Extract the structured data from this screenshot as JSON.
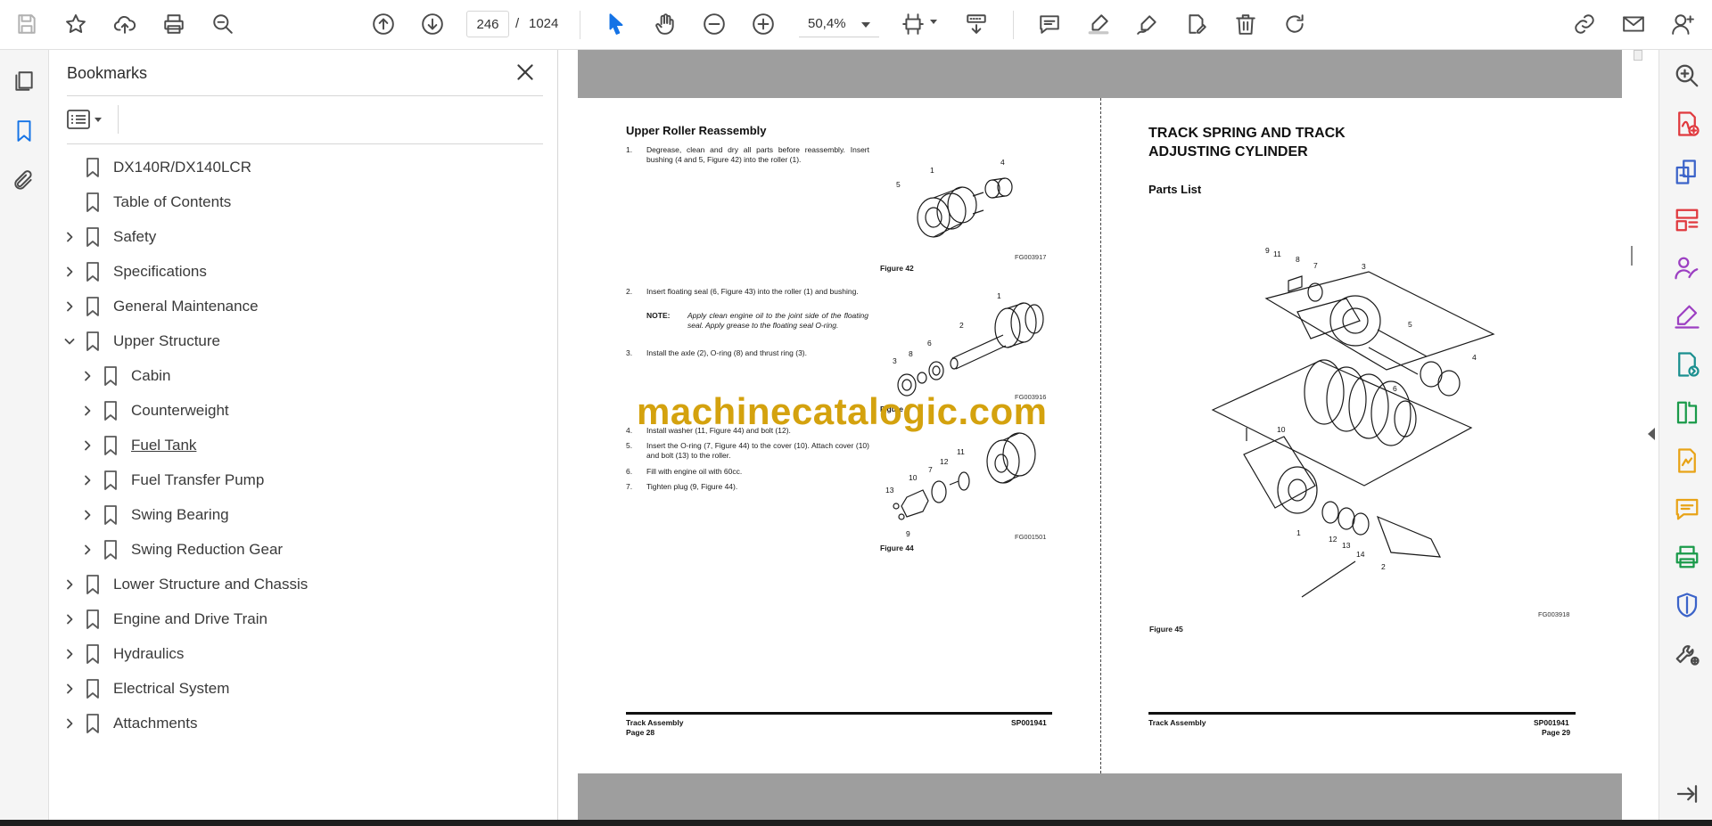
{
  "toolbar": {
    "current_page": "246",
    "page_separator": "/",
    "total_pages": "1024",
    "zoom": "50,4%"
  },
  "bookmarks": {
    "title": "Bookmarks",
    "items": [
      {
        "label": "DX140R/DX140LCR",
        "level": 0,
        "chevron": "none"
      },
      {
        "label": "Table of Contents",
        "level": 0,
        "chevron": "none"
      },
      {
        "label": "Safety",
        "level": 0,
        "chevron": "right"
      },
      {
        "label": "Specifications",
        "level": 0,
        "chevron": "right"
      },
      {
        "label": "General Maintenance",
        "level": 0,
        "chevron": "right"
      },
      {
        "label": "Upper Structure",
        "level": 0,
        "chevron": "down"
      },
      {
        "label": "Cabin",
        "level": 1,
        "chevron": "right"
      },
      {
        "label": "Counterweight",
        "level": 1,
        "chevron": "right"
      },
      {
        "label": "Fuel Tank",
        "level": 1,
        "chevron": "right",
        "underlined": true
      },
      {
        "label": "Fuel Transfer Pump",
        "level": 1,
        "chevron": "right"
      },
      {
        "label": "Swing Bearing",
        "level": 1,
        "chevron": "right"
      },
      {
        "label": "Swing Reduction Gear",
        "level": 1,
        "chevron": "right"
      },
      {
        "label": "Lower Structure and Chassis",
        "level": 0,
        "chevron": "right"
      },
      {
        "label": "Engine and Drive Train",
        "level": 0,
        "chevron": "right"
      },
      {
        "label": "Hydraulics",
        "level": 0,
        "chevron": "right"
      },
      {
        "label": "Electrical System",
        "level": 0,
        "chevron": "right"
      },
      {
        "label": "Attachments",
        "level": 0,
        "chevron": "right"
      }
    ]
  },
  "left_page": {
    "heading": "Upper Roller Reassembly",
    "steps": [
      {
        "num": "1.",
        "text": "Degrease, clean and dry all parts before reassembly. Insert bushing (4 and 5, Figure 42) into the roller (1)."
      },
      {
        "num": "2.",
        "text": "Insert floating seal (6, Figure 43) into the roller (1) and bushing."
      },
      {
        "num": "3.",
        "text": "Install the axle (2), O-ring (8) and thrust ring (3)."
      },
      {
        "num": "4.",
        "text": "Install washer (11, Figure 44) and bolt (12)."
      },
      {
        "num": "5.",
        "text": "Insert the O-ring (7, Figure 44) to the cover (10). Attach cover (10) and bolt (13) to the roller."
      },
      {
        "num": "6.",
        "text": "Fill with engine oil with 60cc."
      },
      {
        "num": "7.",
        "text": "Tighten plug (9, Figure 44)."
      }
    ],
    "note_label": "NOTE:",
    "note_text": "Apply clean engine oil to the joint side of the floating seal. Apply grease to the floating seal O-ring.",
    "fig42": {
      "caption": "Figure 42",
      "code": "FG003917",
      "callouts": [
        "5",
        "1",
        "4"
      ]
    },
    "fig43": {
      "caption": "Figure 4",
      "code": "FG003916",
      "callouts": [
        "1",
        "2",
        "3",
        "8",
        "6"
      ]
    },
    "fig44": {
      "caption": "Figure 44",
      "code": "FG001501",
      "callouts": [
        "10",
        "7",
        "12",
        "11",
        "13",
        "9"
      ]
    },
    "footer_left": "Track Assembly",
    "footer_page": "Page 28",
    "footer_right": "SP001941"
  },
  "right_page": {
    "title_line1": "TRACK SPRING AND TRACK",
    "title_line2": "ADJUSTING CYLINDER",
    "subheading": "Parts List",
    "fig45": {
      "caption": "Figure 45",
      "code": "FG003918",
      "callouts": [
        "9",
        "11",
        "8",
        "7",
        "3",
        "5",
        "4",
        "6",
        "10",
        "1",
        "12",
        "13",
        "14",
        "2"
      ]
    },
    "footer_left": "Track Assembly",
    "footer_page": "Page 29",
    "footer_right": "SP001941"
  },
  "watermark": "machinecatalogic.com",
  "icons": {
    "toolbar": [
      "save-icon",
      "star-icon",
      "upload-icon",
      "print-icon",
      "zoom-search-icon",
      "page-up-icon",
      "page-down-icon",
      "select-cursor-icon",
      "hand-icon",
      "zoom-out-icon",
      "zoom-in-icon",
      "fit-page-icon",
      "scroll-mode-icon",
      "comment-icon",
      "highlight-icon",
      "draw-icon",
      "edit-icon",
      "delete-icon",
      "rotate-icon",
      "share-link-icon",
      "email-icon",
      "account-icon"
    ],
    "right_rail": [
      "zoom-icon",
      "create-pdf-icon",
      "export-pdf-icon",
      "organize-pages-icon",
      "request-signature-icon",
      "fill-sign-icon",
      "send-track-icon",
      "compare-icon",
      "export-file-icon",
      "comment-tool-icon",
      "print-production-icon",
      "protect-icon",
      "more-tools-icon",
      "collapse-rail-icon"
    ]
  },
  "colors": {
    "accent": "#1473e6",
    "watermark": "#d4a20e",
    "page_gutter": "#9e9e9e"
  }
}
